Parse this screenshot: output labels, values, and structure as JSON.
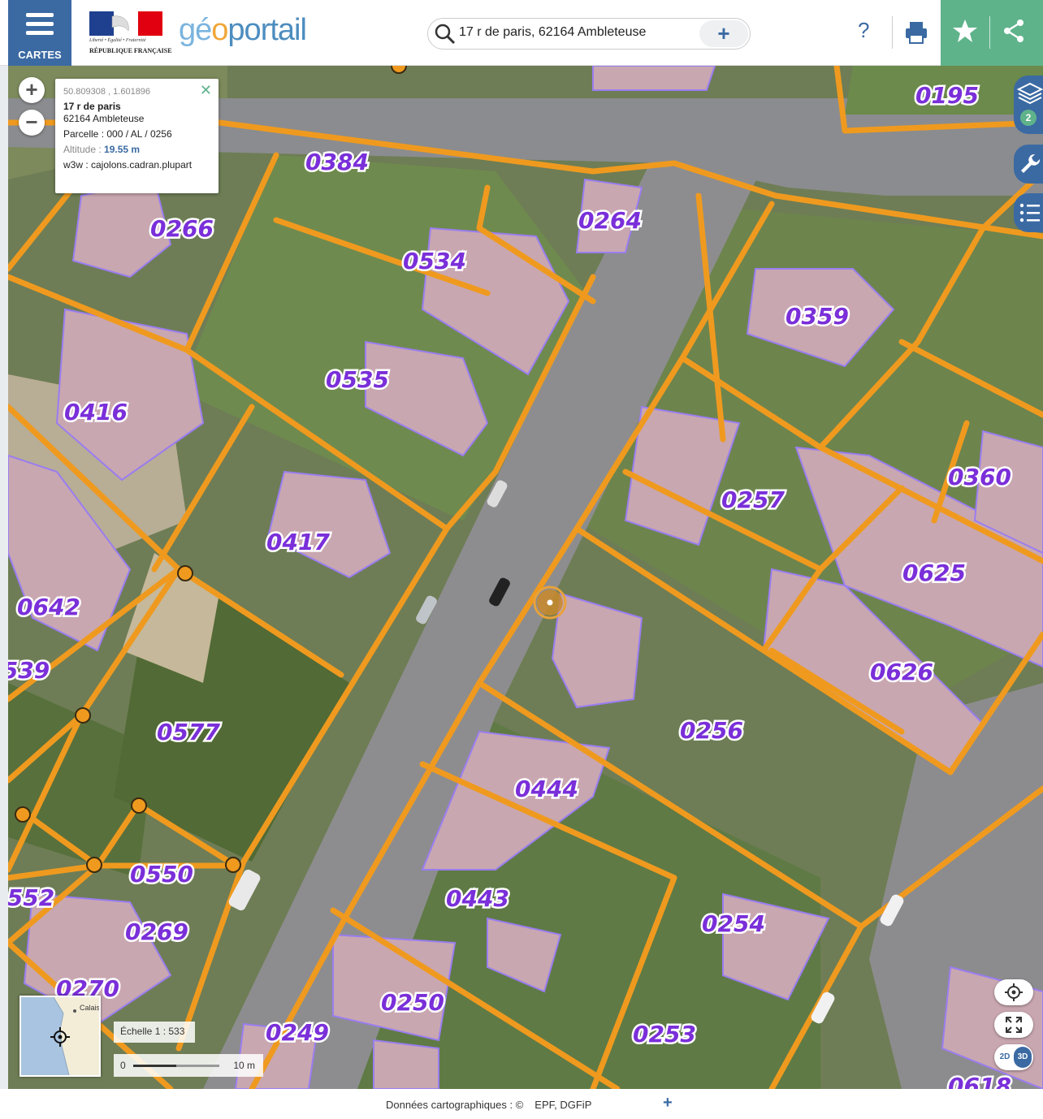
{
  "header": {
    "menu_label": "CARTES",
    "rf_line1": "Liberté • Égalité • Fraternité",
    "rf_line2": "RÉPUBLIQUE FRANÇAISE",
    "brand_geo_1": "gé",
    "brand_geo_2": "o",
    "brand_portail": "portail",
    "search_value": "17 r de paris, 62164 Ambleteuse",
    "help_label": "?"
  },
  "popup": {
    "coords": "50.809308 , 1.601896",
    "address_line1": "17 r de paris",
    "address_line2": "62164 Ambleteuse",
    "parcel": "Parcelle : 000 / AL / 0256",
    "altitude_label": "Altitude : ",
    "altitude_value": "19.55 m",
    "w3w": "w3w : cajolons.cadran.plupart"
  },
  "layers_count": "2",
  "parcels": [
    "0195",
    "0384",
    "0264",
    "0266",
    "0534",
    "0359",
    "0535",
    "0416",
    "0360",
    "0257",
    "0417",
    "0625",
    "0642",
    "0626",
    "539",
    "0256",
    "0577",
    "0444",
    "0550",
    "0443",
    "552",
    "0254",
    "0269",
    "0270",
    "0250",
    "0249",
    "0253",
    "0618"
  ],
  "minimap": {
    "place": "Calais"
  },
  "scale": {
    "text": "Échelle 1 : 533",
    "zero": "0",
    "distance": "10 m"
  },
  "view": {
    "label_2d": "2D",
    "label_3d": "3D"
  },
  "footer": {
    "credits": "Données cartographiques : ©",
    "providers": "EPF, DGFiP"
  },
  "colors": {
    "primary": "#3b6aa3",
    "green": "#5fb38b",
    "parcel_border": "#ef9a1f",
    "parcel_label": "#7a2fd9"
  }
}
